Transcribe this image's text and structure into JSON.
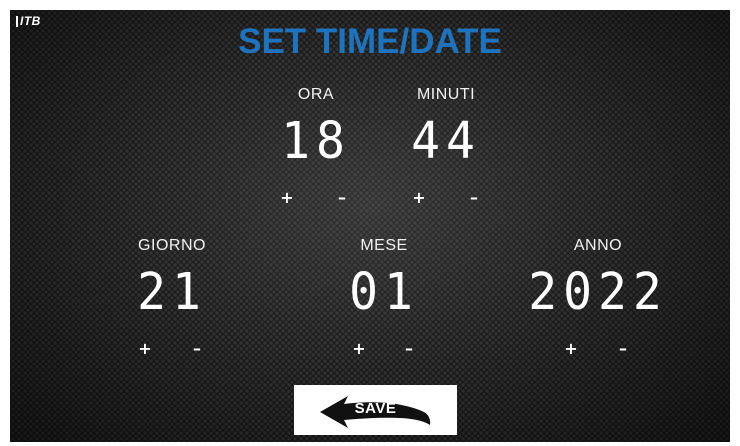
{
  "app": {
    "logo": "ITB",
    "title": "SET TIME/DATE"
  },
  "fields": {
    "ora": {
      "label": "ORA",
      "value": "18",
      "plus": "+",
      "minus": "–"
    },
    "minuti": {
      "label": "MINUTI",
      "value": "44",
      "plus": "+",
      "minus": "–"
    },
    "giorno": {
      "label": "GIORNO",
      "value": "21",
      "plus": "+",
      "minus": "–"
    },
    "mese": {
      "label": "MESE",
      "value": "01",
      "plus": "+",
      "minus": "–"
    },
    "anno": {
      "label": "ANNO",
      "value": "2022",
      "plus": "+",
      "minus": "–"
    }
  },
  "save_button": {
    "label": "SAVE",
    "icon": "back-arrow-icon"
  },
  "colors": {
    "title": "#1e73be",
    "digits": "#ffffff",
    "background": "#1b1b1b"
  }
}
